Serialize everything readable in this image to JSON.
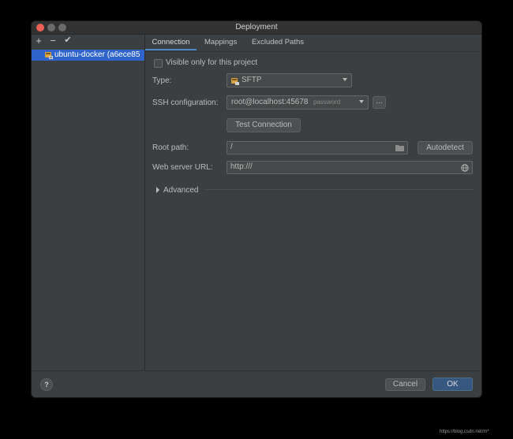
{
  "window": {
    "title": "Deployment"
  },
  "sidebar": {
    "toolbar": {
      "add": "+",
      "remove": "−",
      "apply": "✔"
    },
    "servers": [
      {
        "label": "ubuntu-docker (a6ece85"
      }
    ]
  },
  "tabs": [
    {
      "label": "Connection",
      "active": true
    },
    {
      "label": "Mappings",
      "active": false
    },
    {
      "label": "Excluded Paths",
      "active": false
    }
  ],
  "connection": {
    "visible_only_label": "Visible only for this project",
    "visible_only_checked": false,
    "type_label": "Type:",
    "type_value": "SFTP",
    "ssh_label": "SSH configuration:",
    "ssh_value": "root@localhost:45678",
    "ssh_auth": "password",
    "ssh_more": "...",
    "test_button": "Test Connection",
    "root_label": "Root path:",
    "root_value": "/",
    "autodetect_button": "Autodetect",
    "web_label": "Web server URL:",
    "web_value": "http:///",
    "advanced_label": "Advanced"
  },
  "footer": {
    "help": "?",
    "cancel": "Cancel",
    "ok": "OK"
  },
  "watermark": "https://blog.csdn.net/m*"
}
